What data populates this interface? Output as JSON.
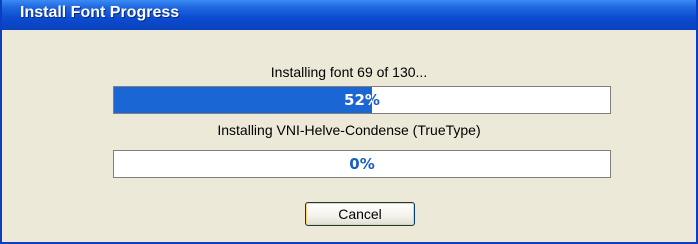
{
  "window": {
    "title": "Install Font Progress"
  },
  "overall": {
    "status": "Installing font 69 of 130...",
    "percent": 52,
    "percent_label": "52%"
  },
  "current": {
    "status": "Installing VNI-Helve-Condense (TrueType)",
    "percent": 0,
    "percent_label": "0%"
  },
  "buttons": {
    "cancel_label": "Cancel"
  },
  "colors": {
    "titlebar": "#0a4bd0",
    "progress_fill": "#1a66d4",
    "window_bg": "#ece9d8"
  }
}
